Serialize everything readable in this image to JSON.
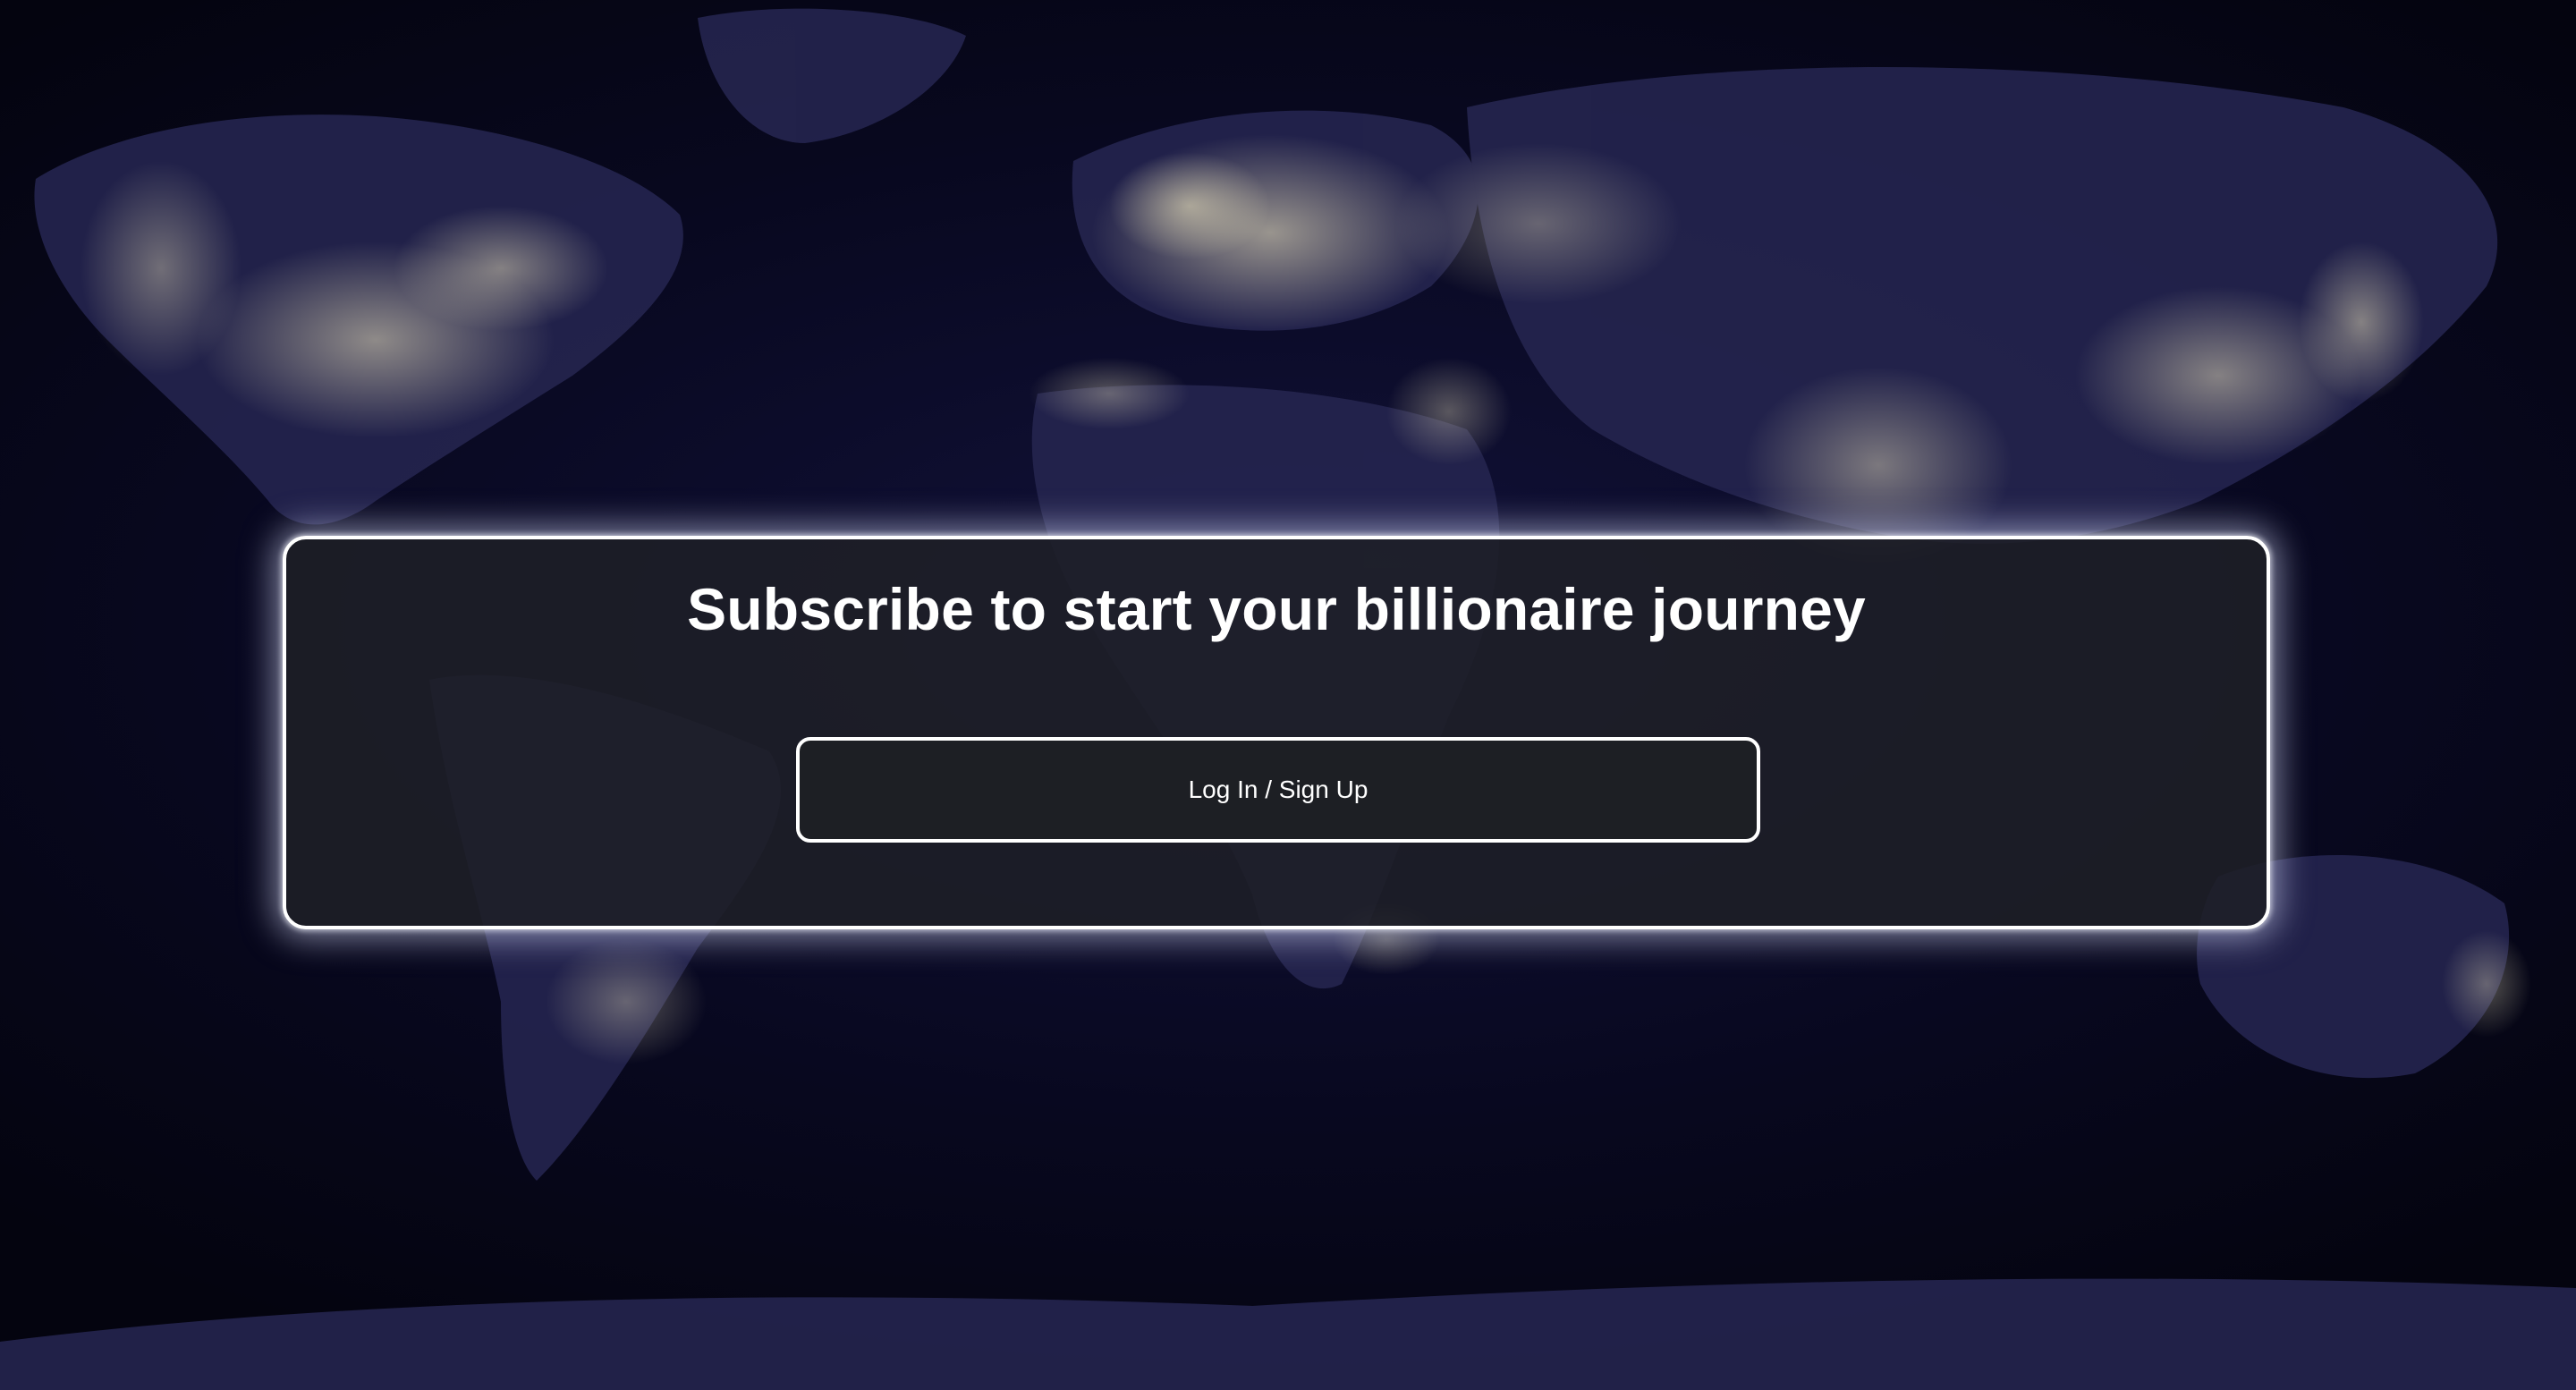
{
  "background": {
    "description_icon": "world-map-night-lights",
    "colors": {
      "ocean": "#05051a",
      "land": "#2a2a5a",
      "city_lights": "#fff6c8"
    }
  },
  "card": {
    "title": "Subscribe to start your billionaire journey",
    "auth_button_label": "Log In / Sign Up",
    "border_color": "#ffffff",
    "fill_color": "#1e2026"
  }
}
